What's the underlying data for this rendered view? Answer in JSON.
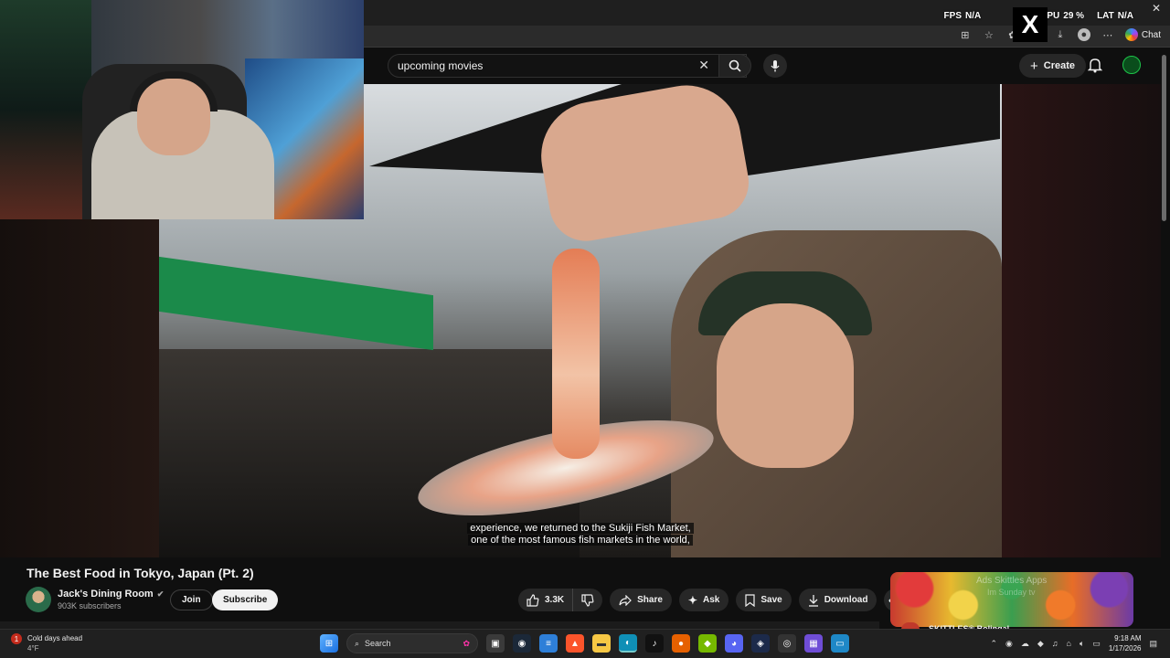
{
  "overlay": {
    "fps_label": "FPS",
    "fps_value": "N/A",
    "pct_fragment": "%",
    "cpu_label": "CPU",
    "cpu_value": "29 %",
    "lat_label": "LAT",
    "lat_value": "N/A"
  },
  "browser": {
    "chat_label": "Chat"
  },
  "youtube": {
    "search_value": "upcoming movies",
    "create_label": "Create"
  },
  "video": {
    "subtitle_line1": "experience, we returned to the Sukiji Fish Market,",
    "subtitle_line2": "one of the most famous fish markets in the world,",
    "title": "The Best Food in Tokyo, Japan (Pt. 2)",
    "channel_name": "Jack's Dining Room",
    "subscribers": "903K subscribers",
    "join_label": "Join",
    "subscribe_label": "Subscribe",
    "likes": "3.3K",
    "share_label": "Share",
    "ask_label": "Ask",
    "save_label": "Save",
    "download_label": "Download"
  },
  "related": {
    "overlay_text1": "Ads Skittles Apps",
    "overlay_text2": "Im Sunday tv",
    "channel_line": "SKITTLES® Bolingal..."
  },
  "taskbar": {
    "weather_badge": "1",
    "weather_title": "Cold days ahead",
    "weather_temp": "4°F",
    "search_label": "Search",
    "time": "9:18 AM",
    "date": "1/17/2026"
  },
  "colors": {
    "background": "#0f0f0f",
    "chip": "#272727",
    "subscribe": "#f1f1f1"
  }
}
